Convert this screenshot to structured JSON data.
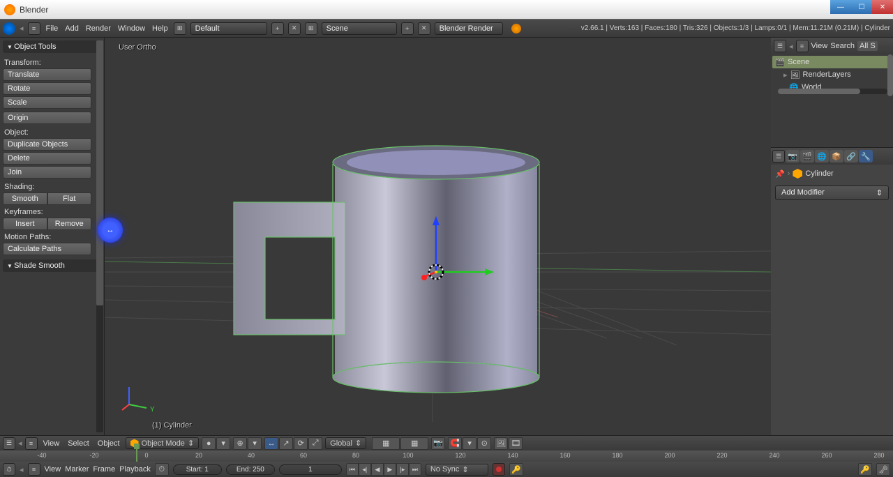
{
  "window": {
    "title": "Blender"
  },
  "win_buttons": {
    "min": "—",
    "max": "☐",
    "close": "✕"
  },
  "header": {
    "menus": [
      "File",
      "Add",
      "Render",
      "Window",
      "Help"
    ],
    "layout_dd": "Default",
    "scene_dd": "Scene",
    "engine_dd": "Blender Render",
    "stats": "v2.66.1 | Verts:163 | Faces:180 | Tris:326 | Objects:1/3 | Lamps:0/1 | Mem:11.21M (0.21M) | Cylinder"
  },
  "toolshelf": {
    "panel1": "Object Tools",
    "transform_lbl": "Transform:",
    "translate": "Translate",
    "rotate": "Rotate",
    "scale": "Scale",
    "origin": "Origin",
    "object_lbl": "Object:",
    "duplicate": "Duplicate Objects",
    "delete": "Delete",
    "join": "Join",
    "shading_lbl": "Shading:",
    "smooth": "Smooth",
    "flat": "Flat",
    "keyframes_lbl": "Keyframes:",
    "insert": "Insert",
    "remove": "Remove",
    "motion_lbl": "Motion Paths:",
    "calc_paths": "Calculate Paths",
    "panel2": "Shade Smooth"
  },
  "viewport": {
    "top_label": "User Ortho",
    "bottom_label": "(1) Cylinder",
    "axis_y": "Y"
  },
  "vp_footer": {
    "menus": [
      "View",
      "Select",
      "Object"
    ],
    "mode": "Object Mode",
    "orient_dd": "Global"
  },
  "outliner": {
    "hdr_view": "View",
    "hdr_search": "Search",
    "hdr_all": "All S",
    "items": [
      {
        "label": "Scene"
      },
      {
        "label": "RenderLayers"
      },
      {
        "label": "World"
      }
    ]
  },
  "props": {
    "object_name": "Cylinder",
    "add_modifier": "Add Modifier"
  },
  "timeline": {
    "ticks": [
      -40,
      -20,
      0,
      20,
      40,
      60,
      80,
      100,
      120,
      140,
      160,
      180,
      200,
      220,
      240,
      260,
      280
    ],
    "menus": [
      "View",
      "Marker",
      "Frame",
      "Playback"
    ],
    "start": "Start: 1",
    "end": "End: 250",
    "current": "1",
    "sync": "No Sync"
  },
  "cursor_arrow": "↔"
}
